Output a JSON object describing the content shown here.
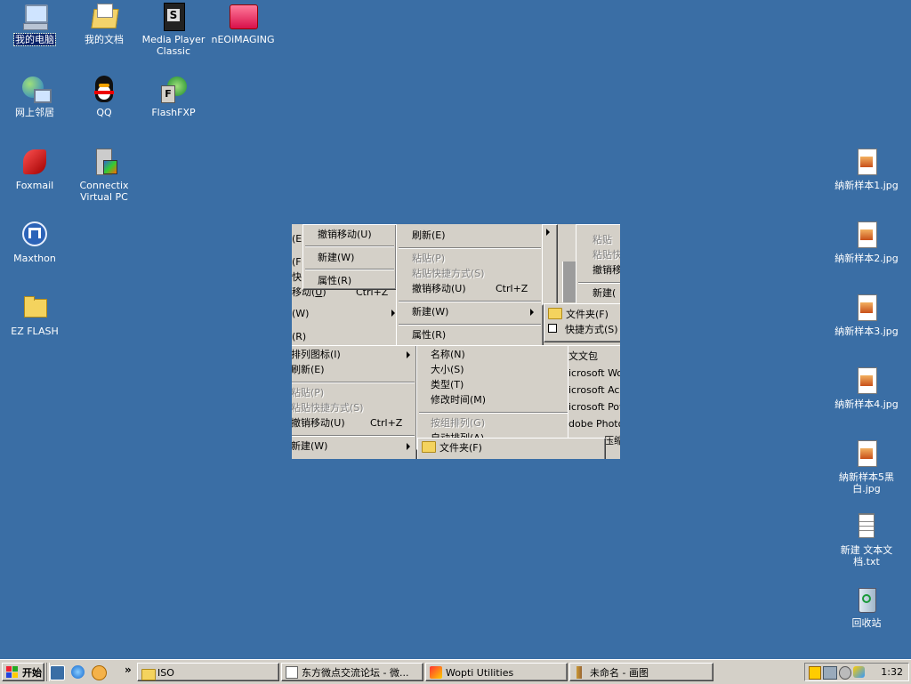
{
  "desktop": {
    "left_icons": [
      {
        "name": "my-computer",
        "label": "我的电脑"
      },
      {
        "name": "my-documents",
        "label": "我的文档"
      },
      {
        "name": "media-player-classic",
        "label": "Media Player Classic"
      },
      {
        "name": "neoimaging",
        "label": "nEOiMAGING"
      },
      {
        "name": "network-places",
        "label": "网上邻居"
      },
      {
        "name": "qq",
        "label": "QQ"
      },
      {
        "name": "flashfxp",
        "label": "FlashFXP"
      },
      {
        "name": "foxmail",
        "label": "Foxmail"
      },
      {
        "name": "connectix-virtual-pc",
        "label": "Connectix Virtual PC"
      },
      {
        "name": "maxthon",
        "label": "Maxthon"
      },
      {
        "name": "ez-flash",
        "label": "EZ FLASH"
      }
    ],
    "right_icons": [
      {
        "name": "sample-1",
        "label": "納新样本1.jpg"
      },
      {
        "name": "sample-2",
        "label": "納新样本2.jpg"
      },
      {
        "name": "sample-3",
        "label": "納新样本3.jpg"
      },
      {
        "name": "sample-4",
        "label": "納新样本4.jpg"
      },
      {
        "name": "sample-5",
        "label": "納新样本5黑白.jpg"
      },
      {
        "name": "new-text-doc",
        "label": "新建 文本文档.txt"
      },
      {
        "name": "recycle-bin",
        "label": "回收站"
      }
    ]
  },
  "menus": {
    "undo_move": "撤销移动(U)",
    "new": "新建(W)",
    "properties": "属性(R)",
    "refresh": "刷新(E)",
    "paste": "粘贴(P)",
    "paste_shortcut": "粘贴快捷方式(S)",
    "ctrl_z": "Ctrl+Z",
    "folder": "文件夹(F)",
    "shortcut": "快捷方式(S)",
    "arrange_icons": "排列图标(I)",
    "name": "名称(N)",
    "size": "大小(S)",
    "type": "类型(T)",
    "modified": "修改时间(M)",
    "group_by": "按组排列(G)",
    "auto_arrange": "自动排列(A)",
    "frag_w": "(W)",
    "frag_r": "(R)",
    "frag_e": "(E",
    "frag_f": "(F",
    "frag_kuai": "快",
    "frag_paste": "粘贴",
    "frag_paste2": "粘贴快",
    "frag_undo": "撤销移",
    "frag_new": "新建(",
    "frag_briefcase": "文文包",
    "frag_word": "icrosoft Wo",
    "frag_access": "icrosoft Acc",
    "frag_ppt": "icrosoft Pow",
    "frag_photoshop": "dobe Photo",
    "frag_zip": "压缩"
  },
  "taskbar": {
    "start": "开始",
    "iso": "ISO",
    "forum": "东方微点交流论坛 - 微...",
    "wopti": "Wopti Utilities",
    "paint": "未命名 - 画图",
    "clock": "1:32",
    "chevron": "»"
  }
}
